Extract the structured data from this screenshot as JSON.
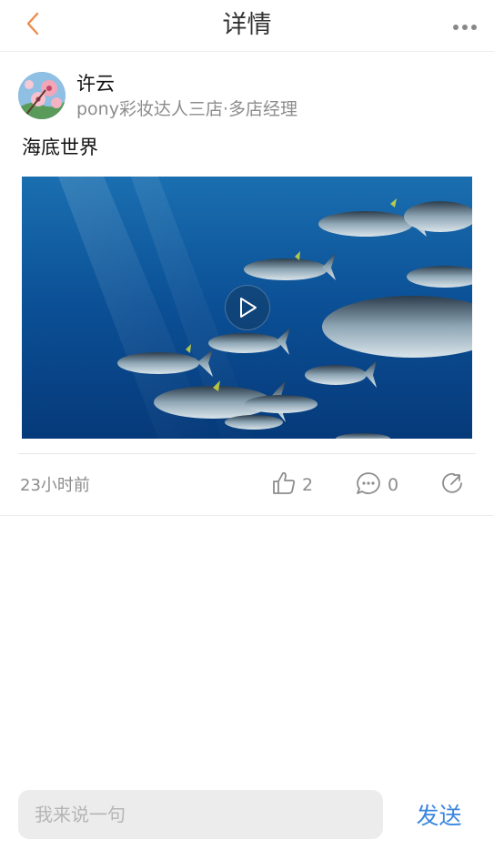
{
  "header": {
    "title": "详情",
    "back_icon": "chevron-left-icon",
    "more_icon": "more-horizontal-icon",
    "accent_color": "#f08a4b"
  },
  "post": {
    "author": {
      "name": "许云",
      "subtitle": "pony彩妆达人三店·多店经理",
      "avatar_icon": "avatar-flower-image"
    },
    "text": "海底世界",
    "media": {
      "type": "video",
      "play_icon": "play-icon"
    },
    "time": "23小时前",
    "likes": "2",
    "comments": "0",
    "like_icon": "thumb-up-icon",
    "comment_icon": "comment-bubble-icon",
    "share_icon": "share-icon"
  },
  "composer": {
    "placeholder": "我来说一句",
    "send_label": "发送",
    "send_color": "#3a86e0"
  }
}
